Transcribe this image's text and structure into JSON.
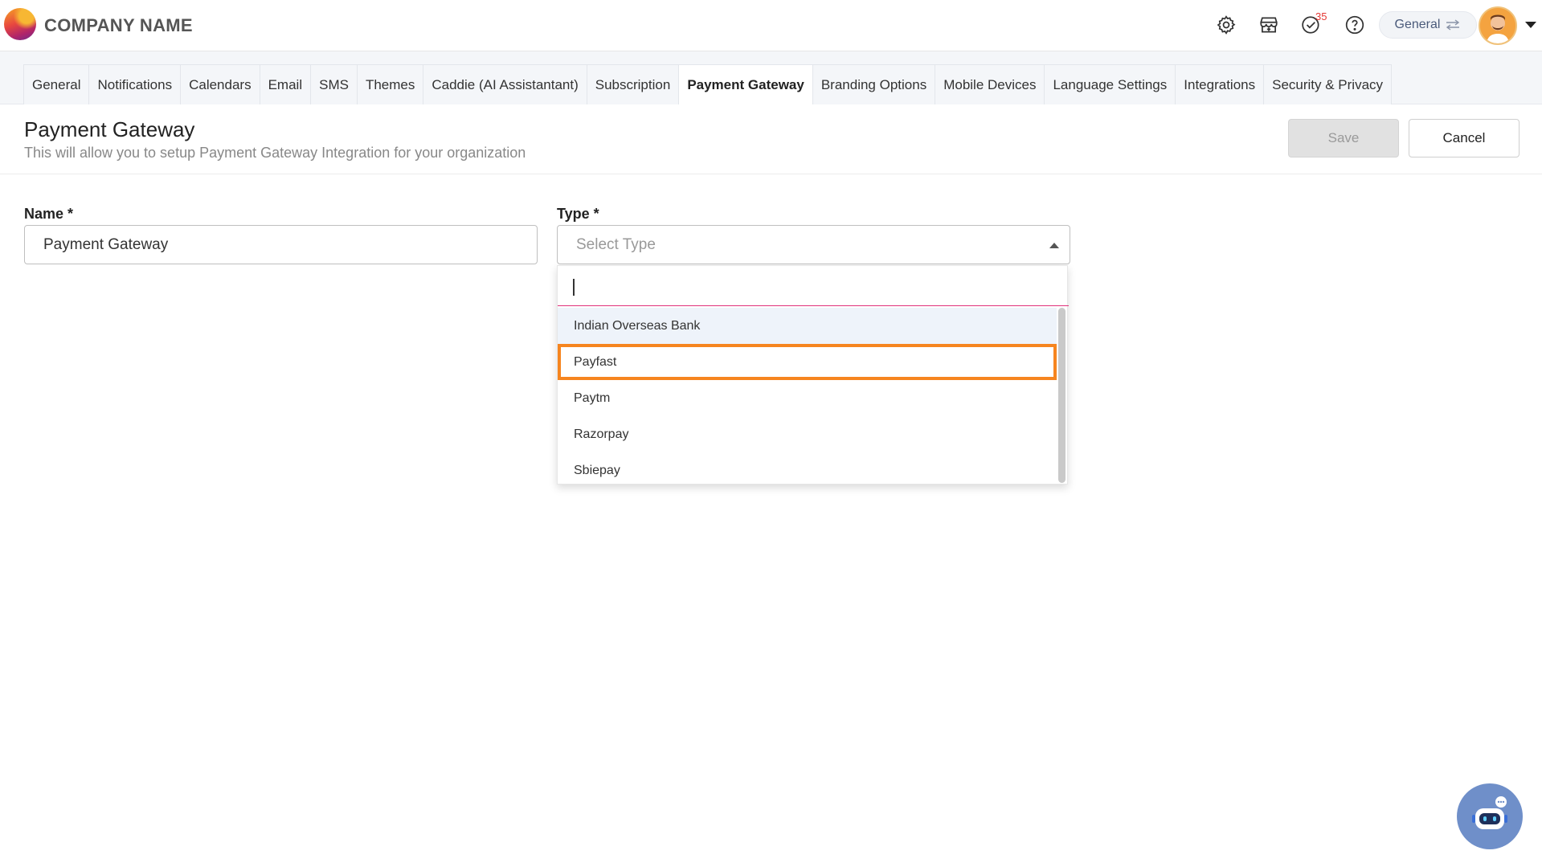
{
  "header": {
    "company_name": "COMPANY NAME",
    "notification_count": "35",
    "org_switch_label": "General"
  },
  "tabs": [
    {
      "label": "General"
    },
    {
      "label": "Notifications"
    },
    {
      "label": "Calendars"
    },
    {
      "label": "Email"
    },
    {
      "label": "SMS"
    },
    {
      "label": "Themes"
    },
    {
      "label": "Caddie (AI Assistantant)"
    },
    {
      "label": "Subscription"
    },
    {
      "label": "Payment Gateway",
      "active": true
    },
    {
      "label": "Branding Options"
    },
    {
      "label": "Mobile Devices"
    },
    {
      "label": "Language Settings"
    },
    {
      "label": "Integrations"
    },
    {
      "label": "Security & Privacy"
    }
  ],
  "page": {
    "title": "Payment Gateway",
    "subtitle": "This will allow you to setup Payment Gateway Integration for your organization",
    "save_label": "Save",
    "cancel_label": "Cancel"
  },
  "form": {
    "name_label": "Name *",
    "name_value": "Payment Gateway",
    "type_label": "Type *",
    "type_placeholder": "Select Type",
    "type_options": [
      "Indian Overseas Bank",
      "Payfast",
      "Paytm",
      "Razorpay",
      "Sbiepay"
    ]
  },
  "colors": {
    "accent_focus": "#f6851f",
    "search_underline": "#e0307a",
    "chatbot_bg": "#6f8fc9"
  }
}
